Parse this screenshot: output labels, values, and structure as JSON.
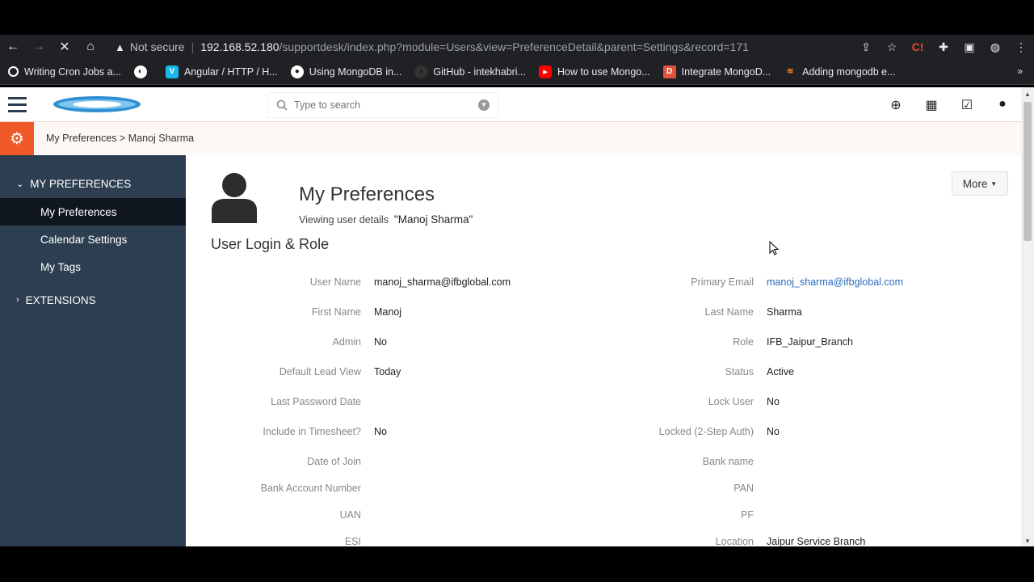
{
  "browser": {
    "not_secure": "Not secure",
    "host": "192.168.52.180",
    "path": "/supportdesk/index.php?module=Users&view=PreferenceDetail&parent=Settings&record=171",
    "bookmarks": [
      {
        "label": "Writing Cron Jobs a...",
        "icon": "github-circle-icon",
        "color": "#ffffff"
      },
      {
        "label": "Angular / HTTP / H...",
        "icon": "vimeo-icon",
        "color": "#1ab7ea"
      },
      {
        "label": "Using MongoDB in...",
        "icon": "github-icon",
        "color": "#ffffff"
      },
      {
        "label": "GitHub - intekhabri...",
        "icon": "github-icon",
        "color": "#333333"
      },
      {
        "label": "How to use Mongo...",
        "icon": "youtube-icon",
        "color": "#ff0000"
      },
      {
        "label": "Integrate MongoD...",
        "icon": "d-icon",
        "color": "#e0533d"
      },
      {
        "label": "Adding mongodb e...",
        "icon": "stack-icon",
        "color": "#f48024"
      }
    ],
    "more": "»"
  },
  "header": {
    "search_placeholder": "Type to search"
  },
  "breadcrumb": {
    "text": "My Preferences > Manoj Sharma"
  },
  "sidebar": {
    "group1": "MY PREFERENCES",
    "items": [
      "My Preferences",
      "Calendar Settings",
      "My Tags"
    ],
    "group2": "EXTENSIONS"
  },
  "main": {
    "title": "My Preferences",
    "viewing_prefix": "Viewing user details",
    "viewing_name": "\"Manoj Sharma\"",
    "more_label": "More",
    "section_title": "User Login & Role",
    "rows": [
      {
        "l_label": "User Name",
        "l_value": "manoj_sharma@ifbglobal.com",
        "r_label": "Primary Email",
        "r_value": "manoj_sharma@ifbglobal.com"
      },
      {
        "l_label": "First Name",
        "l_value": "Manoj",
        "r_label": "Last Name",
        "r_value": "Sharma"
      },
      {
        "l_label": "Admin",
        "l_value": "No",
        "r_label": "Role",
        "r_value": "IFB_Jaipur_Branch"
      },
      {
        "l_label": "Default Lead View",
        "l_value": "Today",
        "r_label": "Status",
        "r_value": "Active"
      },
      {
        "l_label": "Last Password Date",
        "l_value": "",
        "r_label": "Lock User",
        "r_value": "No"
      },
      {
        "l_label": "Include in Timesheet?",
        "l_value": "No",
        "r_label": "Locked (2-Step Auth)",
        "r_value": "No"
      },
      {
        "l_label": "Date of Join",
        "l_value": "",
        "r_label": "Bank name",
        "r_value": ""
      },
      {
        "l_label": "Bank Account Number",
        "l_value": "",
        "r_label": "PAN",
        "r_value": ""
      },
      {
        "l_label": "UAN",
        "l_value": "",
        "r_label": "PF",
        "r_value": ""
      },
      {
        "l_label": "ESI",
        "l_value": "",
        "r_label": "Location",
        "r_value": "Jaipur Service Branch"
      }
    ]
  },
  "colors": {
    "sidebar_bg": "#2c3e50",
    "accent": "#f05a28",
    "link": "#2a6dbb"
  }
}
